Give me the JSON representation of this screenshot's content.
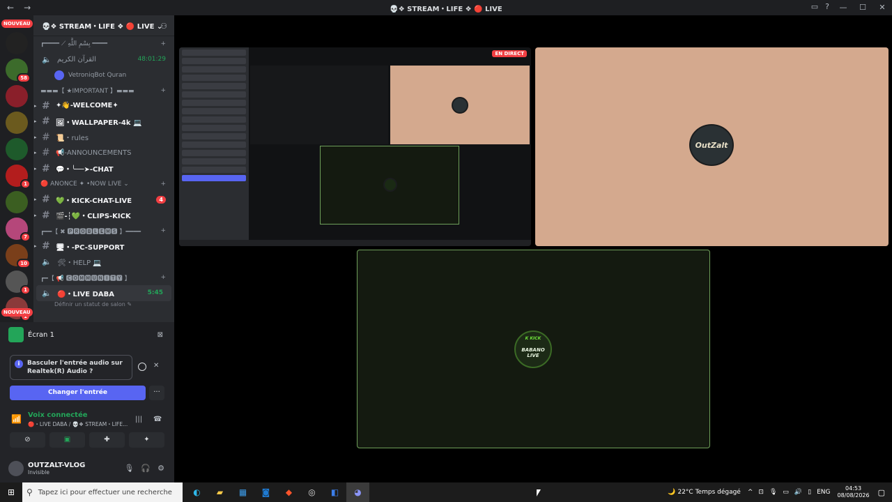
{
  "window": {
    "title": "💀❖ STREAM・LIFE ❖ 🔴 LIVE",
    "controls": [
      "—",
      "☐",
      "✕"
    ]
  },
  "servers": {
    "nouveau_label": "NOUVEAU",
    "badges": [
      "58",
      "1",
      "7",
      "10",
      "1",
      "1",
      "2"
    ]
  },
  "guild": {
    "name": "💀❖ STREAM・LIFE ❖ 🔴 LIVE ⌄"
  },
  "channels": [
    {
      "type": "cat",
      "label": "┏━━━━ ⟋ بِسْمِ اللَّهِ ━━━━"
    },
    {
      "type": "voice",
      "label": "القرآن الكريم",
      "time": "48:01:29"
    },
    {
      "type": "user",
      "label": "VetroniqBot Quran"
    },
    {
      "type": "cat",
      "label": "▬▬▬【 ★IMPORTANT 】▬▬▬"
    },
    {
      "type": "text",
      "label": "✦👋-WELCOME✦",
      "bright": true
    },
    {
      "type": "text",
      "label": "🖼・WALLPAPER-4k 💻",
      "bright": true
    },
    {
      "type": "text",
      "label": "📜・rules",
      "bright": false
    },
    {
      "type": "text",
      "label": "📢-ANNOUNCEMENTS",
      "bright": false
    },
    {
      "type": "text",
      "label": "💬・╰──➤-CHAT",
      "bright": true
    },
    {
      "type": "cat",
      "label": "🔴 ANONCE ✦ •NOW LIVE ⌄"
    },
    {
      "type": "text",
      "label": "💚・KICK-CHAT-LIVE",
      "bright": true,
      "count": "4"
    },
    {
      "type": "text",
      "label": "🎬-┆💚・CLIPS-KICK",
      "bright": true
    },
    {
      "type": "cat",
      "label": "┏━━【 ✖ 🅿🆁🅾🅱🅻🅴🅼🆂 】━━━━"
    },
    {
      "type": "text",
      "label": "🖥・-PC-SUPPORT",
      "bright": true
    },
    {
      "type": "voice",
      "label": "🛠・HELP 💻"
    },
    {
      "type": "cat",
      "label": "┏━【 📢 🅲🅾🅼🅼🆄🅽🅸🆃🆈 】"
    },
    {
      "type": "live",
      "label": "🔴・LIVE DABA",
      "time": "5:45"
    }
  ],
  "status_line": "Définir un statut de salon ✎",
  "panel": {
    "screen_label": "Écran 1",
    "notice_text": "Basculer l'entrée audio sur Realtek(R) Audio ?",
    "change_button": "Changer l'entrée",
    "more": "···",
    "voice_connected": "Voix connectée",
    "voice_channel": "🔴・LIVE DABA / 💀❖ STREAM・LIFE...",
    "user_name": "OUTZALT-VLOG",
    "user_status": "Invisible"
  },
  "stage": {
    "en_direct": "EN DIRECT",
    "logo_top": "OutZalt",
    "logo_bottom": "BABANO LIVE",
    "logo_kick": "K KICK"
  },
  "taskbar": {
    "search_placeholder": "Tapez ici pour effectuer une recherche",
    "weather": "22°C  Temps dégagé",
    "lang": "ENG",
    "time": "04:53",
    "date": "08/08/2026"
  },
  "colors": {
    "accent": "#5865f2",
    "green": "#23a559",
    "red": "#f23f43",
    "tan": "#d4a98e"
  }
}
